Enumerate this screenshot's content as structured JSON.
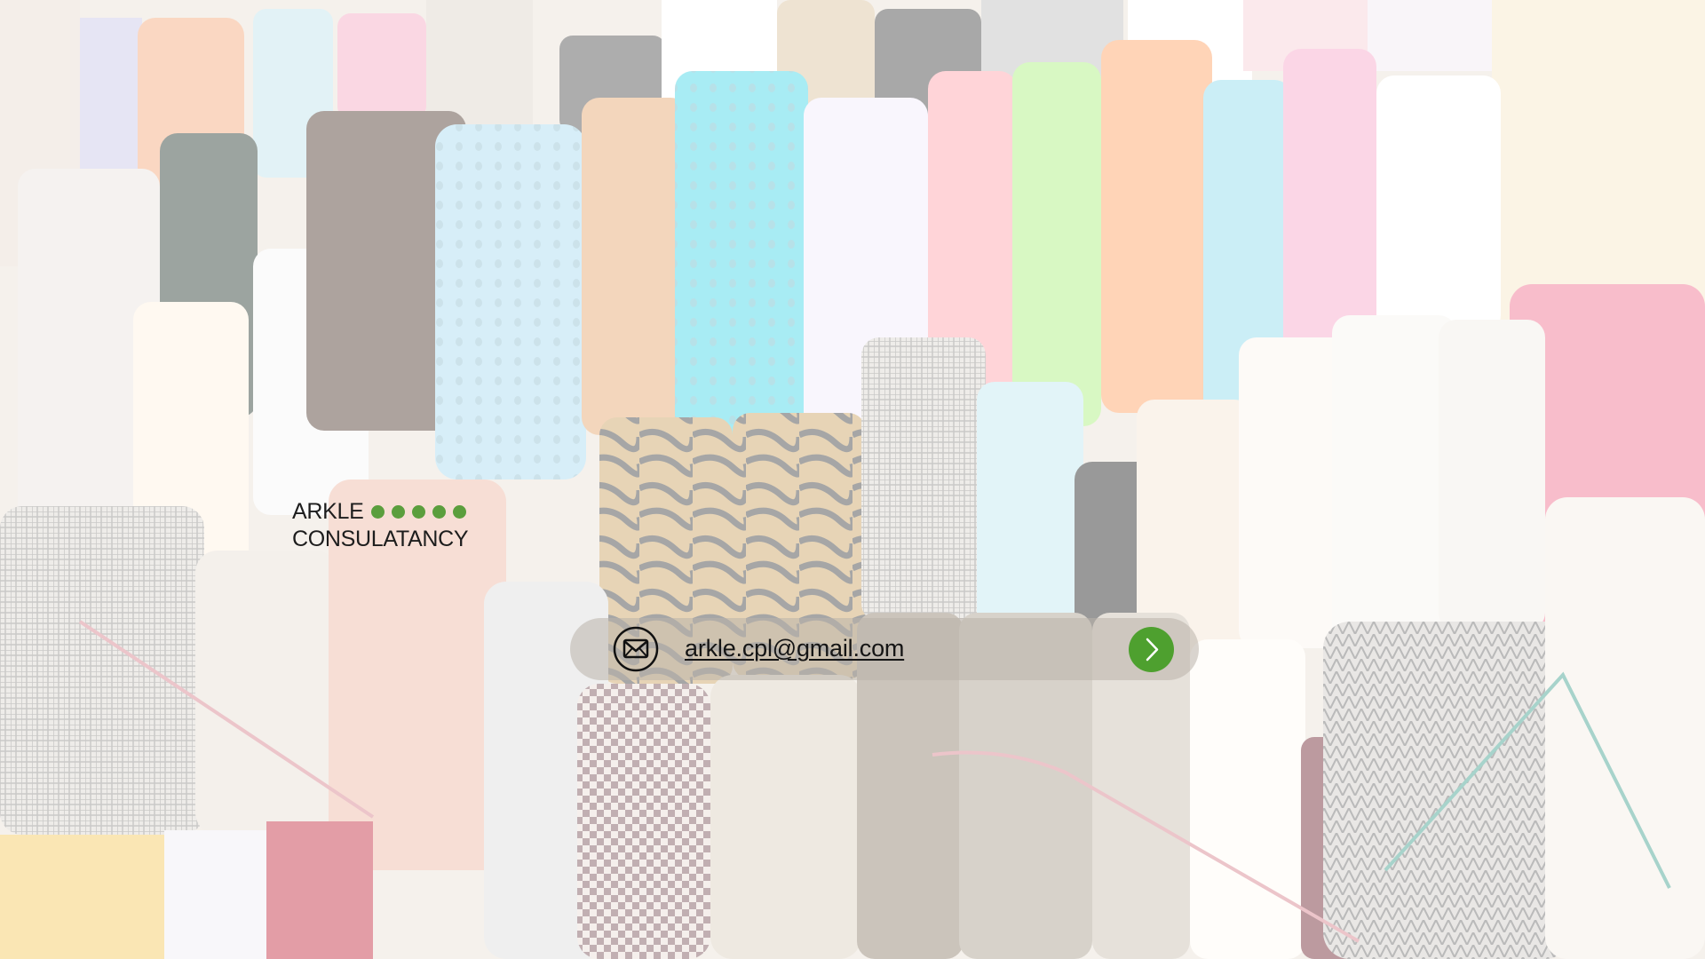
{
  "logo": {
    "line1": "ARKLE",
    "line2": "CONSULATANCY",
    "dot_count": 5,
    "dot_color": "#5b9e3d"
  },
  "contact": {
    "email": "arkle.cpl@gmail.com",
    "icon": "mail-icon",
    "submit_icon": "chevron-right-icon",
    "accent_color": "#4ea02f"
  }
}
